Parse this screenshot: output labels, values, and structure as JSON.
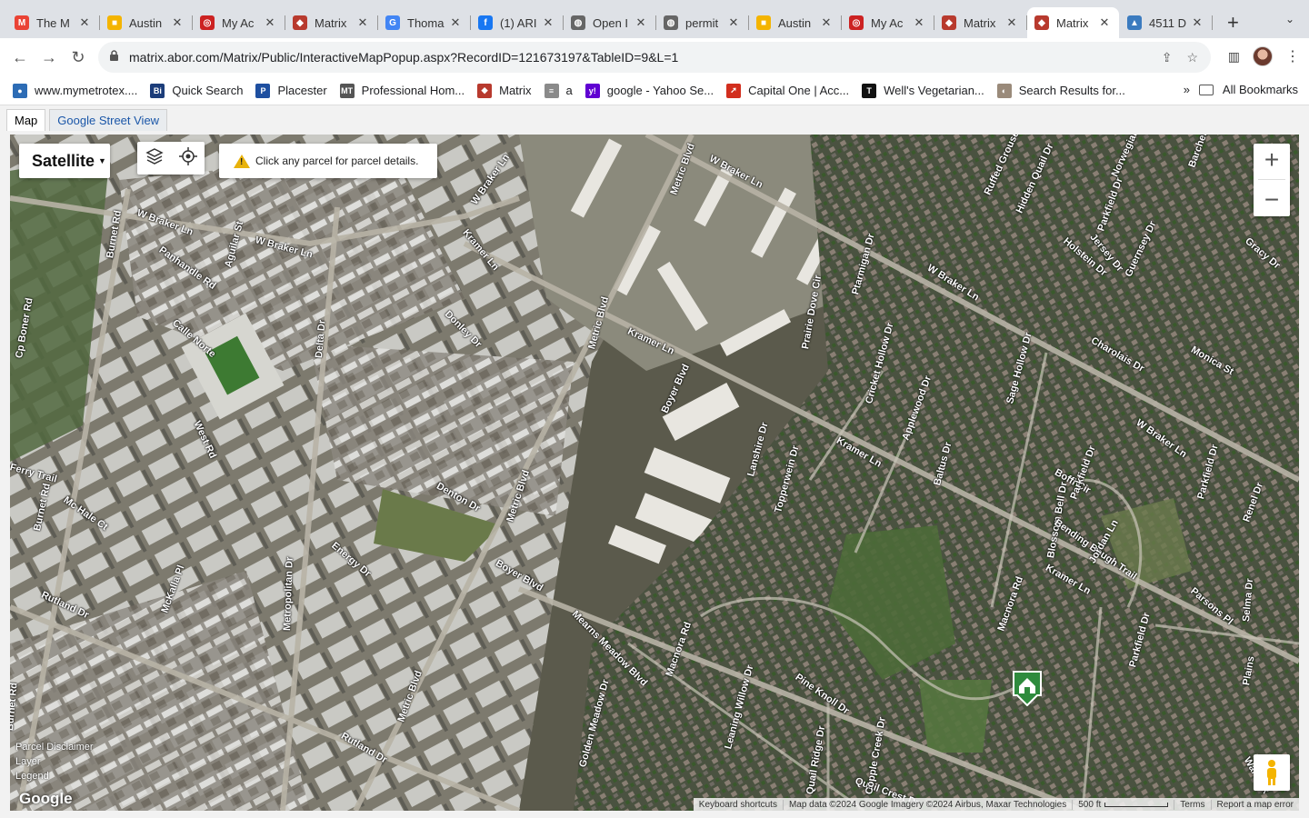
{
  "tabs": [
    {
      "title": "The M",
      "icon": "gmail-icon",
      "color": "#ea4335",
      "glyph": "M"
    },
    {
      "title": "Austin",
      "icon": "sheet-icon",
      "color": "#f4b400",
      "glyph": "■"
    },
    {
      "title": "My Ac",
      "icon": "target-icon",
      "color": "#cc2222",
      "glyph": "◎"
    },
    {
      "title": "Matrix",
      "icon": "matrix-icon",
      "color": "#b83a2e",
      "glyph": "◆"
    },
    {
      "title": "Thoma",
      "icon": "google-icon",
      "color": "#4285f4",
      "glyph": "G"
    },
    {
      "title": "(1) ARI",
      "icon": "facebook-icon",
      "color": "#1877f2",
      "glyph": "f"
    },
    {
      "title": "Open I",
      "icon": "globe-icon",
      "color": "#666666",
      "glyph": "◍"
    },
    {
      "title": "permit",
      "icon": "globe-icon",
      "color": "#666666",
      "glyph": "◍"
    },
    {
      "title": "Austin",
      "icon": "sheet-icon",
      "color": "#f4b400",
      "glyph": "■"
    },
    {
      "title": "My Ac",
      "icon": "target-icon",
      "color": "#cc2222",
      "glyph": "◎"
    },
    {
      "title": "Matrix",
      "icon": "matrix-icon",
      "color": "#b83a2e",
      "glyph": "◆"
    },
    {
      "title": "Matrix",
      "icon": "matrix-icon",
      "color": "#b83a2e",
      "glyph": "◆",
      "active": true
    },
    {
      "title": "4511 D",
      "icon": "house-icon",
      "color": "#3b7bbf",
      "glyph": "▲"
    }
  ],
  "address": {
    "url": "matrix.abor.com/Matrix/Public/InteractiveMapPopup.aspx?RecordID=121673197&TableID=9&L=1"
  },
  "bookmarks": [
    {
      "label": "www.mymetrotex....",
      "icon": "metrotex-icon",
      "color": "#2d6cb5",
      "glyph": "●"
    },
    {
      "label": "Quick Search",
      "icon": "quicksearch-icon",
      "color": "#1c3d7a",
      "glyph": "Bi"
    },
    {
      "label": "Placester",
      "icon": "placester-icon",
      "color": "#1e4fa0",
      "glyph": "P"
    },
    {
      "label": "Professional Hom...",
      "icon": "mt-icon",
      "color": "#555555",
      "glyph": "MT"
    },
    {
      "label": "Matrix",
      "icon": "matrix-icon",
      "color": "#b83a2e",
      "glyph": "◆"
    },
    {
      "label": "a",
      "icon": "doc-icon",
      "color": "#8a8a8a",
      "glyph": "≡"
    },
    {
      "label": "google - Yahoo Se...",
      "icon": "yahoo-icon",
      "color": "#6001d2",
      "glyph": "y!"
    },
    {
      "label": "Capital One | Acc...",
      "icon": "capitalone-icon",
      "color": "#d22e1e",
      "glyph": "➚"
    },
    {
      "label": "Well's Vegetarian...",
      "icon": "nyt-icon",
      "color": "#111111",
      "glyph": "T"
    },
    {
      "label": "Search Results for...",
      "icon": "search-results-icon",
      "color": "#9a8a7a",
      "glyph": "◐"
    }
  ],
  "bookmarks_more": "»",
  "all_bookmarks": "All Bookmarks",
  "page_tabs": {
    "map": "Map",
    "street_view": "Google Street View"
  },
  "map": {
    "type_label": "Satellite",
    "notice": "Click any parcel for parcel details.",
    "links": [
      "Parcel Disclaimer",
      "Layer",
      "Legend"
    ],
    "logo": "Google",
    "footer": {
      "shortcuts": "Keyboard shortcuts",
      "attribution": "Map data ©2024 Google Imagery ©2024 Airbus, Maxar Technologies",
      "scale": "500 ft",
      "terms": "Terms",
      "report": "Report a map error"
    },
    "streets": [
      {
        "label": "W Braker Ln"
      },
      {
        "label": "W Braker Ln"
      },
      {
        "label": "W Braker Ln"
      },
      {
        "label": "W Braker Ln"
      },
      {
        "label": "W Braker Ln"
      },
      {
        "label": "W Braker Ln"
      },
      {
        "label": "Kramer Ln"
      },
      {
        "label": "Kramer Ln"
      },
      {
        "label": "Kramer Ln"
      },
      {
        "label": "Kramer Ln"
      },
      {
        "label": "Metric Blvd"
      },
      {
        "label": "Metric Blvd"
      },
      {
        "label": "Metric Blvd"
      },
      {
        "label": "Metric Blvd"
      },
      {
        "label": "Burnet Rd"
      },
      {
        "label": "Burnet Rd"
      },
      {
        "label": "Burnet Rd"
      },
      {
        "label": "Panhandle Rd"
      },
      {
        "label": "Aguilar St"
      },
      {
        "label": "Calle Norte"
      },
      {
        "label": "Cp Boner Rd"
      },
      {
        "label": "Delta Dr"
      },
      {
        "label": "Donley Dr"
      },
      {
        "label": "West Rd"
      },
      {
        "label": "Denton Dr"
      },
      {
        "label": "Boyer Blvd"
      },
      {
        "label": "Boyer Blvd"
      },
      {
        "label": "Energy Dr"
      },
      {
        "label": "Metropolitan Dr"
      },
      {
        "label": "Mc Hale Ct"
      },
      {
        "label": "Rutland Dr"
      },
      {
        "label": "Rutland Dr"
      },
      {
        "label": "McKalla Pl"
      },
      {
        "label": "Ferry Trail"
      },
      {
        "label": "Mearns Meadow Blvd"
      },
      {
        "label": "Macnora Rd"
      },
      {
        "label": "Macnora Rd"
      },
      {
        "label": "Golden Meadow Dr"
      },
      {
        "label": "Leaning Willow Dr"
      },
      {
        "label": "Pine Knoll Dr"
      },
      {
        "label": "Quail Ridge Dr"
      },
      {
        "label": "Quail Crest Dr"
      },
      {
        "label": "Copple Creek Dr"
      },
      {
        "label": "Lanshire Dr"
      },
      {
        "label": "Topperwein Dr"
      },
      {
        "label": "Prairie Dove Cir"
      },
      {
        "label": "Ptarmigan Dr"
      },
      {
        "label": "Cricket Hollow Dr"
      },
      {
        "label": "Applewood Dr"
      },
      {
        "label": "Baltus Dr"
      },
      {
        "label": "Sage Hollow Dr"
      },
      {
        "label": "Blossom Bell Dr"
      },
      {
        "label": "Bending Bough Trail"
      },
      {
        "label": "Boffi Cir"
      },
      {
        "label": "Jordan Ln"
      },
      {
        "label": "Parkfield Dr"
      },
      {
        "label": "Parkfield Dr"
      },
      {
        "label": "Parkfield Dr"
      },
      {
        "label": "Parkfield Dr"
      },
      {
        "label": "Parsons Pl"
      },
      {
        "label": "Charolais Dr"
      },
      {
        "label": "Monica St"
      },
      {
        "label": "Holstein Dr"
      },
      {
        "label": "Jersey Dr"
      },
      {
        "label": "Guernsey Dr"
      },
      {
        "label": "Hidden Quail Dr"
      },
      {
        "label": "Ruffed Grouse Dr"
      },
      {
        "label": "Norwegian"
      },
      {
        "label": "Barchetta"
      },
      {
        "label": "Gracy Dr"
      },
      {
        "label": "Renel Dr"
      },
      {
        "label": "Selma Dr"
      },
      {
        "label": "Plains"
      },
      {
        "label": "Warwick"
      }
    ]
  }
}
